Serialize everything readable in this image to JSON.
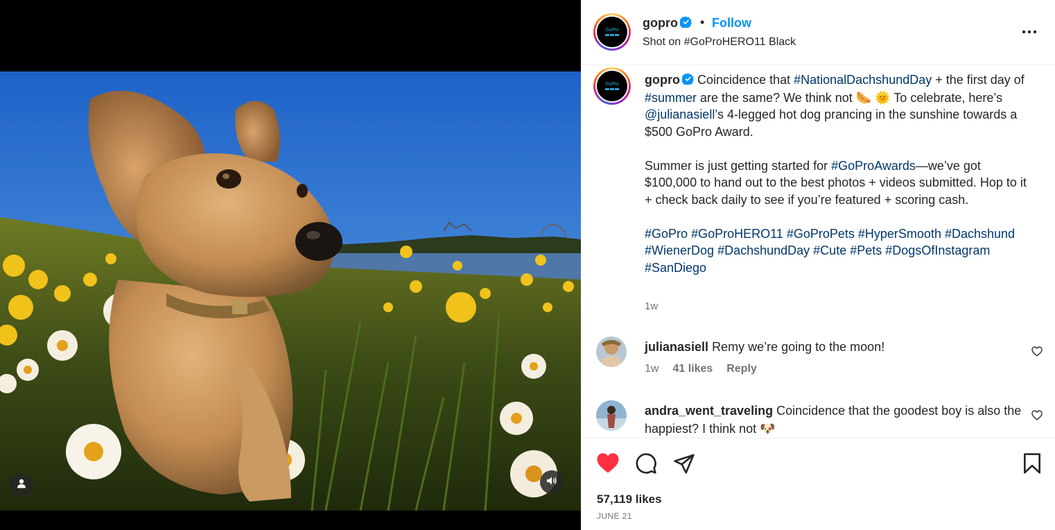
{
  "media": {
    "user_icon": "user-icon",
    "sound_icon": "speaker-icon"
  },
  "header": {
    "username": "gopro",
    "separator": "•",
    "follow_label": "Follow",
    "location": "Shot on #GoProHERO11 Black",
    "more_icon": "more-horizontal-icon",
    "avatar_logo_text": "GoPro"
  },
  "caption": {
    "username": "gopro",
    "p1": [
      {
        "t": "Coincidence that ",
        "k": "text"
      },
      {
        "t": "#NationalDachshundDay",
        "k": "tag"
      },
      {
        "t": " + the first day of ",
        "k": "text"
      },
      {
        "t": "#summer",
        "k": "tag"
      },
      {
        "t": " are the same? We think not 🌭 🌞 To celebrate, here’s ",
        "k": "text"
      },
      {
        "t": "@julianasiell",
        "k": "tag"
      },
      {
        "t": "’s 4-legged hot dog prancing in the sunshine towards a $500 GoPro Award.",
        "k": "text"
      }
    ],
    "p2": [
      {
        "t": "Summer is just getting started for ",
        "k": "text"
      },
      {
        "t": "#GoProAwards",
        "k": "tag"
      },
      {
        "t": "—we’ve got $100,000 to hand out to the best photos + videos submitted. Hop to it + check back daily to see if you’re featured + scoring cash.",
        "k": "text"
      }
    ],
    "hashtags": [
      "#GoPro",
      "#GoProHERO11",
      "#GoProPets",
      "#HyperSmooth",
      "#Dachshund",
      "#WienerDog",
      "#DachshundDay",
      "#Cute",
      "#Pets",
      "#DogsOfInstagram",
      "#SanDiego"
    ],
    "time": "1w"
  },
  "comments": [
    {
      "username": "julianasiell",
      "text": "Remy we’re going to the moon!",
      "time": "1w",
      "likes": "41 likes",
      "reply": "Reply"
    },
    {
      "username": "andra_went_traveling",
      "text": "Coincidence that the goodest boy is also the happiest? I think not 🐶"
    }
  ],
  "actions": {
    "like_icon": "heart-filled-icon",
    "comment_icon": "comment-icon",
    "share_icon": "share-icon",
    "save_icon": "bookmark-icon",
    "like_color": "#ff3040"
  },
  "footer": {
    "likes": "57,119 likes",
    "date": "JUNE 21"
  }
}
